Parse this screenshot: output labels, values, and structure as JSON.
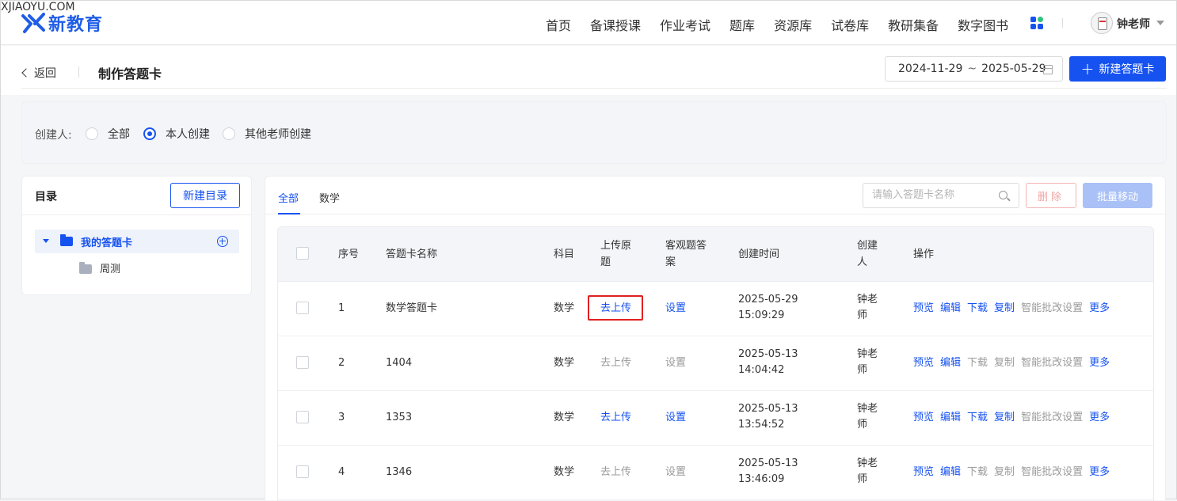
{
  "brand": {
    "name": "新教育",
    "tagline": "XJIAOYU.COM",
    "blue": "#1652f0"
  },
  "nav": [
    "首页",
    "备课授课",
    "作业考试",
    "题库",
    "资源库",
    "试卷库",
    "教研集备",
    "数字图书"
  ],
  "user": {
    "name": "钟老师"
  },
  "page": {
    "back_label": "返回",
    "title": "制作答题卡",
    "date_start": "2024-11-29",
    "date_sep": "~",
    "date_end": "2025-05-29",
    "new_button": "新建答题卡"
  },
  "filter": {
    "label": "创建人:",
    "options": [
      "全部",
      "本人创建",
      "其他老师创建"
    ],
    "selected": "本人创建"
  },
  "directory": {
    "title": "目录",
    "new_button": "新建目录",
    "root": "我的答题卡",
    "children": [
      "周测"
    ]
  },
  "tabs": [
    "全部",
    "数学"
  ],
  "active_tab": "全部",
  "search": {
    "placeholder": "请输入答题卡名称"
  },
  "actions": {
    "delete": "删除",
    "batch_move": "批量移动"
  },
  "table": {
    "headers": {
      "index": "序号",
      "name": "答题卡名称",
      "subject": "科目",
      "upload_1": "上传原",
      "upload_2": "题",
      "objective_1": "客观题答",
      "objective_2": "案",
      "created_time": "创建时间",
      "creator_1": "创建",
      "creator_2": "人",
      "ops": "操作"
    },
    "rows": [
      {
        "index": "1",
        "name": "数学答题卡",
        "subject": "数学",
        "upload": "去上传",
        "objective": "设置",
        "date": "2025-05-29",
        "time": "15:09:29",
        "creator_1": "钟老",
        "creator_2": "师",
        "ops": [
          "预览",
          "编辑",
          "下载",
          "复制",
          "智能批改设置",
          "更多"
        ]
      },
      {
        "index": "2",
        "name": "1404",
        "subject": "数学",
        "upload": "去上传",
        "objective": "设置",
        "date": "2025-05-13",
        "time": "14:04:42",
        "creator_1": "钟老",
        "creator_2": "师",
        "ops": [
          "预览",
          "编辑",
          "下载",
          "复制",
          "智能批改设置",
          "更多"
        ]
      },
      {
        "index": "3",
        "name": "1353",
        "subject": "数学",
        "upload": "去上传",
        "objective": "设置",
        "date": "2025-05-13",
        "time": "13:54:52",
        "creator_1": "钟老",
        "creator_2": "师",
        "ops": [
          "预览",
          "编辑",
          "下载",
          "复制",
          "智能批改设置",
          "更多"
        ]
      },
      {
        "index": "4",
        "name": "1346",
        "subject": "数学",
        "upload": "去上传",
        "objective": "设置",
        "date": "2025-05-13",
        "time": "13:46:09",
        "creator_1": "钟老",
        "creator_2": "师",
        "ops": [
          "预览",
          "编辑",
          "下载",
          "复制",
          "智能批改设置",
          "更多"
        ]
      }
    ]
  }
}
